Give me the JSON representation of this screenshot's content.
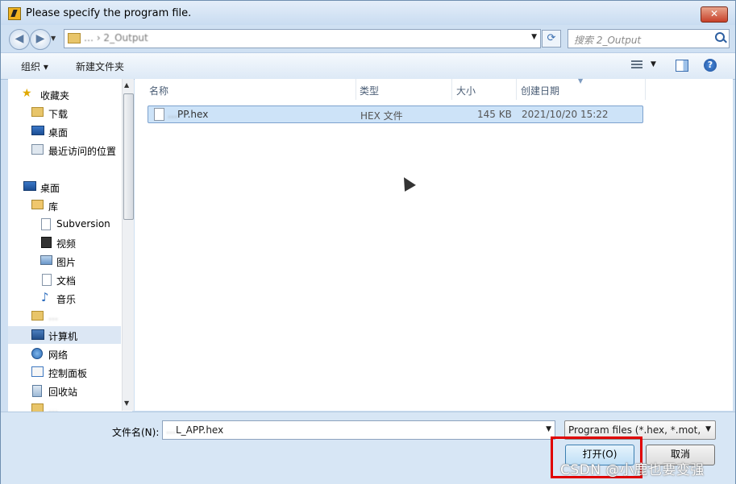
{
  "window": {
    "title": "Please specify the program file."
  },
  "address": {
    "path_text": "… › 2_Output",
    "search_placeholder": "搜索 2_Output"
  },
  "toolbar": {
    "organize_label": "组织 ▾",
    "new_folder_label": "新建文件夹"
  },
  "nav": {
    "favorites": "收藏夹",
    "downloads": "下载",
    "desktop_fav": "桌面",
    "recent": "最近访问的位置",
    "desktop": "桌面",
    "libraries": "库",
    "subversion": "Subversion",
    "videos": "视频",
    "pictures": "图片",
    "documents": "文档",
    "music": "音乐",
    "user_folder": "…",
    "computer": "计算机",
    "network": "网络",
    "control_panel": "控制面板",
    "recycle_bin": "回收站",
    "more": "…"
  },
  "columns": {
    "name": "名称",
    "type": "类型",
    "size": "大小",
    "date": "创建日期"
  },
  "files": [
    {
      "name_hidden": "…",
      "name_visible": "PP.hex",
      "type": "HEX 文件",
      "size": "145 KB",
      "date": "2021/10/20 15:22"
    }
  ],
  "footer": {
    "filename_label": "文件名(N):",
    "filename_hidden": "…",
    "filename_visible": "L_APP.hex",
    "filetype": "Program files (*.hex, *.mot, *",
    "open_label": "打开(O)",
    "cancel_label": "取消",
    "watermark": "CSDN @小鹿也要变强"
  },
  "colors": {
    "highlight": "#e00000",
    "selection": "#cde3f8"
  }
}
